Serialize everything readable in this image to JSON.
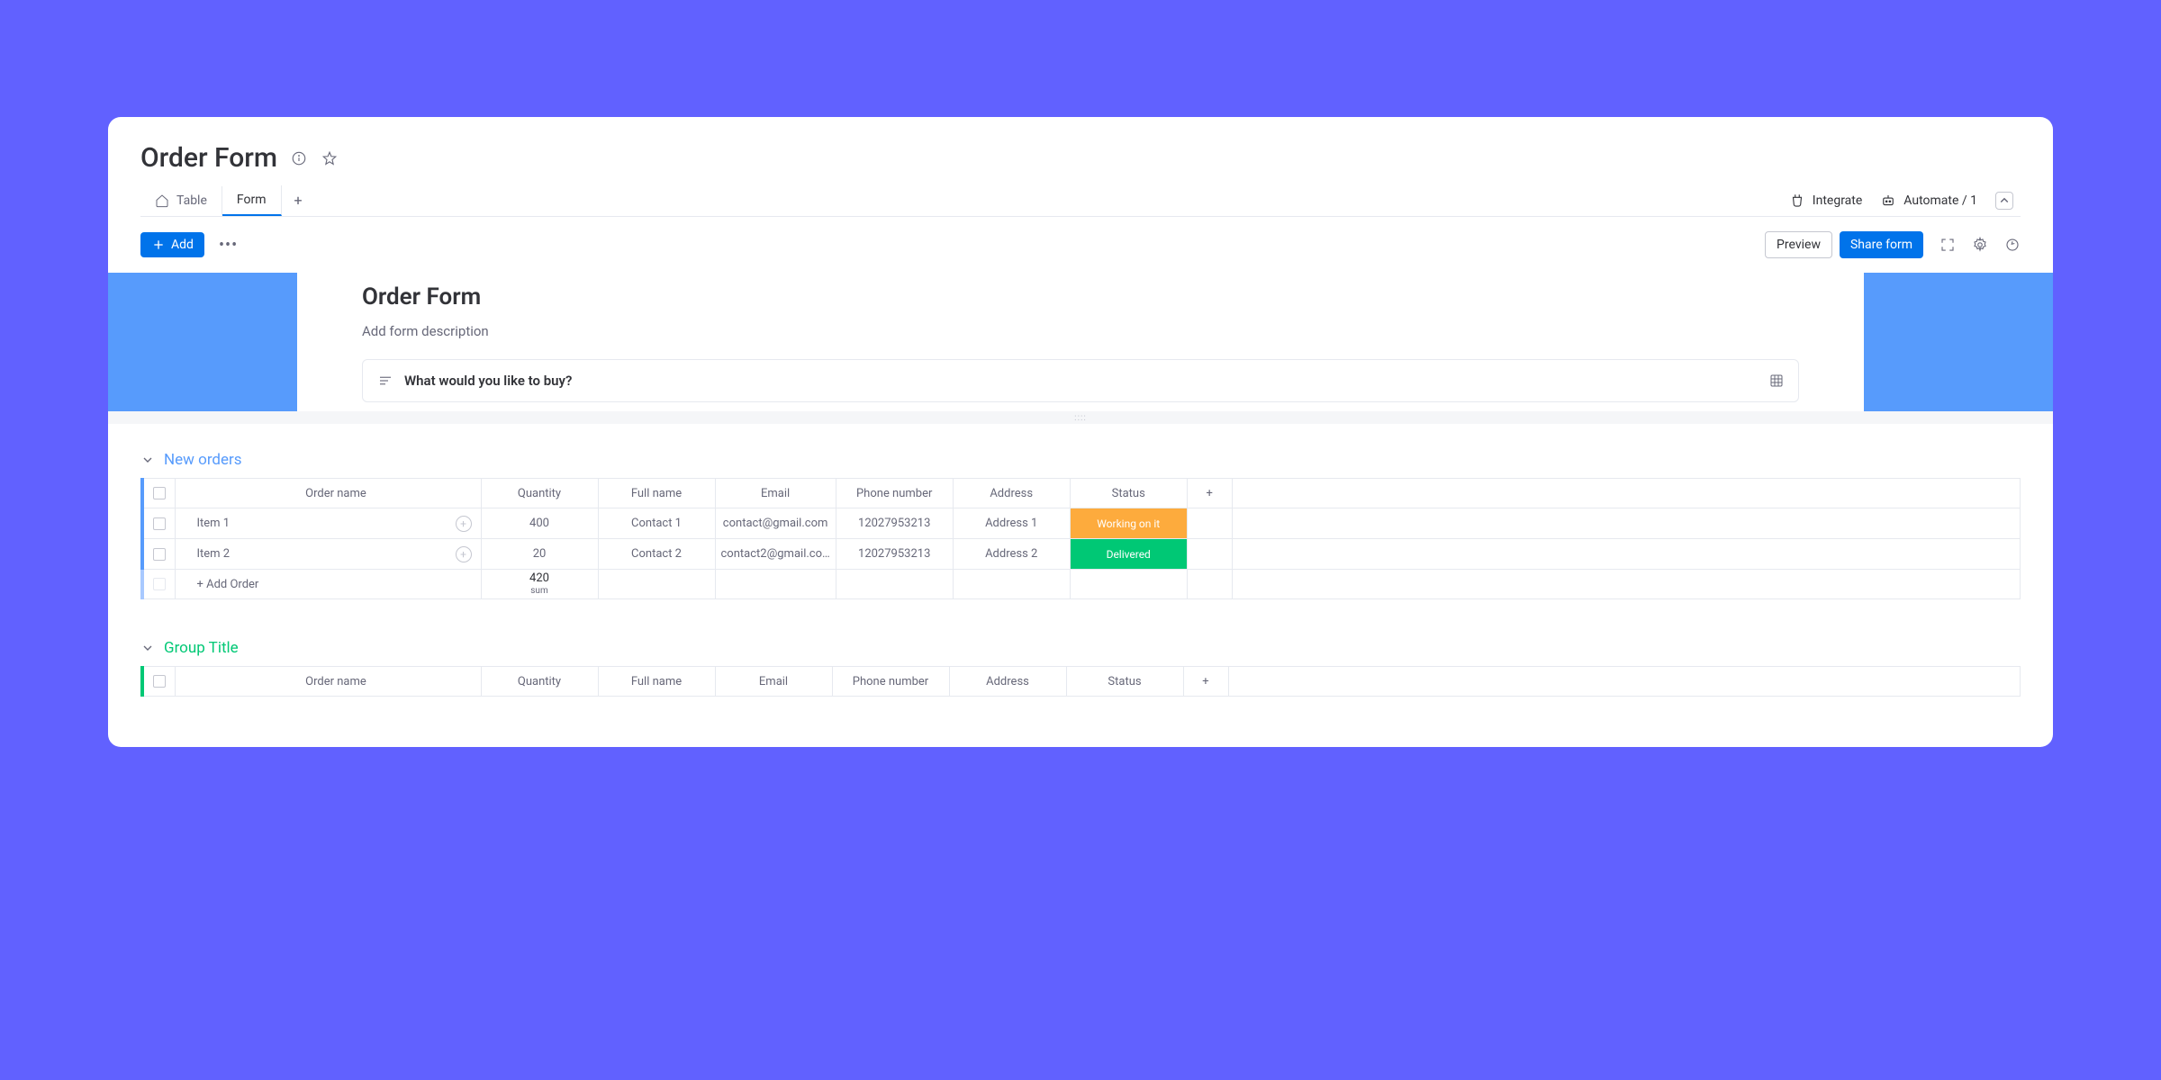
{
  "page_title": "Order Form",
  "tabs": {
    "table": "Table",
    "form": "Form"
  },
  "header_actions": {
    "integrate": "Integrate",
    "automate": "Automate / 1"
  },
  "toolbar": {
    "add": "Add",
    "preview": "Preview",
    "share": "Share form"
  },
  "form_banner": {
    "title": "Order Form",
    "description": "Add form description",
    "question": "What would you like to buy?"
  },
  "columns": {
    "order_name": "Order name",
    "quantity": "Quantity",
    "full_name": "Full name",
    "email": "Email",
    "phone": "Phone number",
    "address": "Address",
    "status": "Status"
  },
  "group1": {
    "title": "New orders",
    "rows": [
      {
        "name": "Item 1",
        "quantity": "400",
        "full_name": "Contact 1",
        "email": "contact@gmail.com",
        "phone": "12027953213",
        "address": "Address 1",
        "status": "Working on it"
      },
      {
        "name": "Item 2",
        "quantity": "20",
        "full_name": "Contact 2",
        "email": "contact2@gmail.co…",
        "phone": "12027953213",
        "address": "Address 2",
        "status": "Delivered"
      }
    ],
    "add_row": "+ Add Order",
    "sum_value": "420",
    "sum_label": "sum"
  },
  "group2": {
    "title": "Group Title"
  }
}
